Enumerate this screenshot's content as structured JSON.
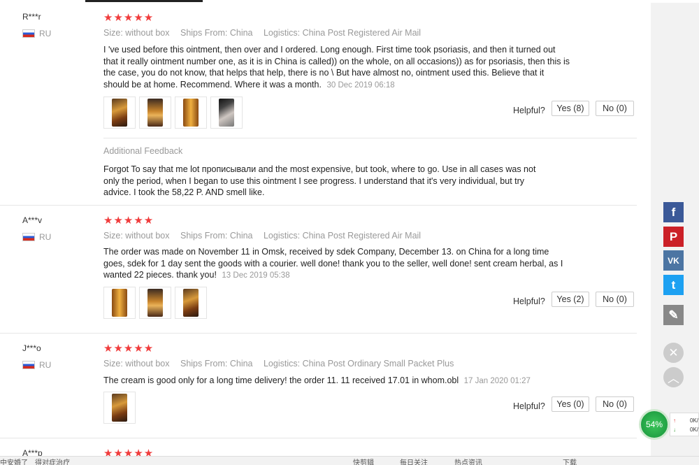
{
  "reviews": [
    {
      "user": "R***r",
      "country": "RU",
      "stars": "★★★★★",
      "size": "Size: without box",
      "ships_from": "Ships From: China",
      "logistics": "Logistics: China Post Registered Air Mail",
      "text": "I 've used before this ointment, then over and I ordered. Long enough. First time took psoriasis, and then it turned out that it really ointment number one, as it is in China is called)) on the whole, on all occasions)) as for psoriasis, then this is the case, you do not know, that helps that help, there is no \\ But have almost no, ointment used this. Believe that it should be at home. Recommend. Where it was a month.",
      "date": "30 Dec 2019 06:18",
      "helpful_label": "Helpful?",
      "yes": "Yes (8)",
      "no": "No (0)",
      "additional_label": "Additional Feedback",
      "additional_text": "Forgot To say that me lot прописывали and the most expensive, but took, where to go. Use in all cases was not only the period, when I began to use this ointment I see progress. I understand that it's very individual, but try advice. I took the 58,22 P. AND smell like."
    },
    {
      "user": "A***v",
      "country": "RU",
      "stars": "★★★★★",
      "size": "Size: without box",
      "ships_from": "Ships From: China",
      "logistics": "Logistics: China Post Registered Air Mail",
      "text": "The order was made on November 11 in Omsk, received by sdek Company, December 13. on China for a long time goes, sdek for 1 day sent the goods with a courier. well done! thank you to the seller, well done! sent cream herbal, as I wanted 22 pieces. thank you!",
      "date": "13 Dec 2019 05:38",
      "helpful_label": "Helpful?",
      "yes": "Yes (2)",
      "no": "No (0)"
    },
    {
      "user": "J***o",
      "country": "RU",
      "stars": "★★★★★",
      "size": "Size: without box",
      "ships_from": "Ships From: China",
      "logistics": "Logistics: China Post Ordinary Small Packet Plus",
      "text": "The cream is good only for a long time delivery! the order 11. 11 received 17.01 in whom.obl",
      "date": "17 Jan 2020 01:27",
      "helpful_label": "Helpful?",
      "yes": "Yes (0)",
      "no": "No (0)"
    },
    {
      "user": "A***p",
      "stars": "★★★★★"
    }
  ],
  "sidebar": {
    "facebook": "f",
    "pinterest": "P",
    "vk": "VK",
    "twitter": "t",
    "edit_icon": "✎",
    "close_icon": "✕",
    "up_icon": "︿"
  },
  "speed": {
    "percent": "54%",
    "up": "0K/",
    "down": "0K/"
  },
  "taskbar": {
    "left1": "中安婚了",
    "left2": "得对症治疗",
    "item1": "快剪辑",
    "item2": "每日关注",
    "item3": "热点资讯",
    "item4": "下载"
  }
}
